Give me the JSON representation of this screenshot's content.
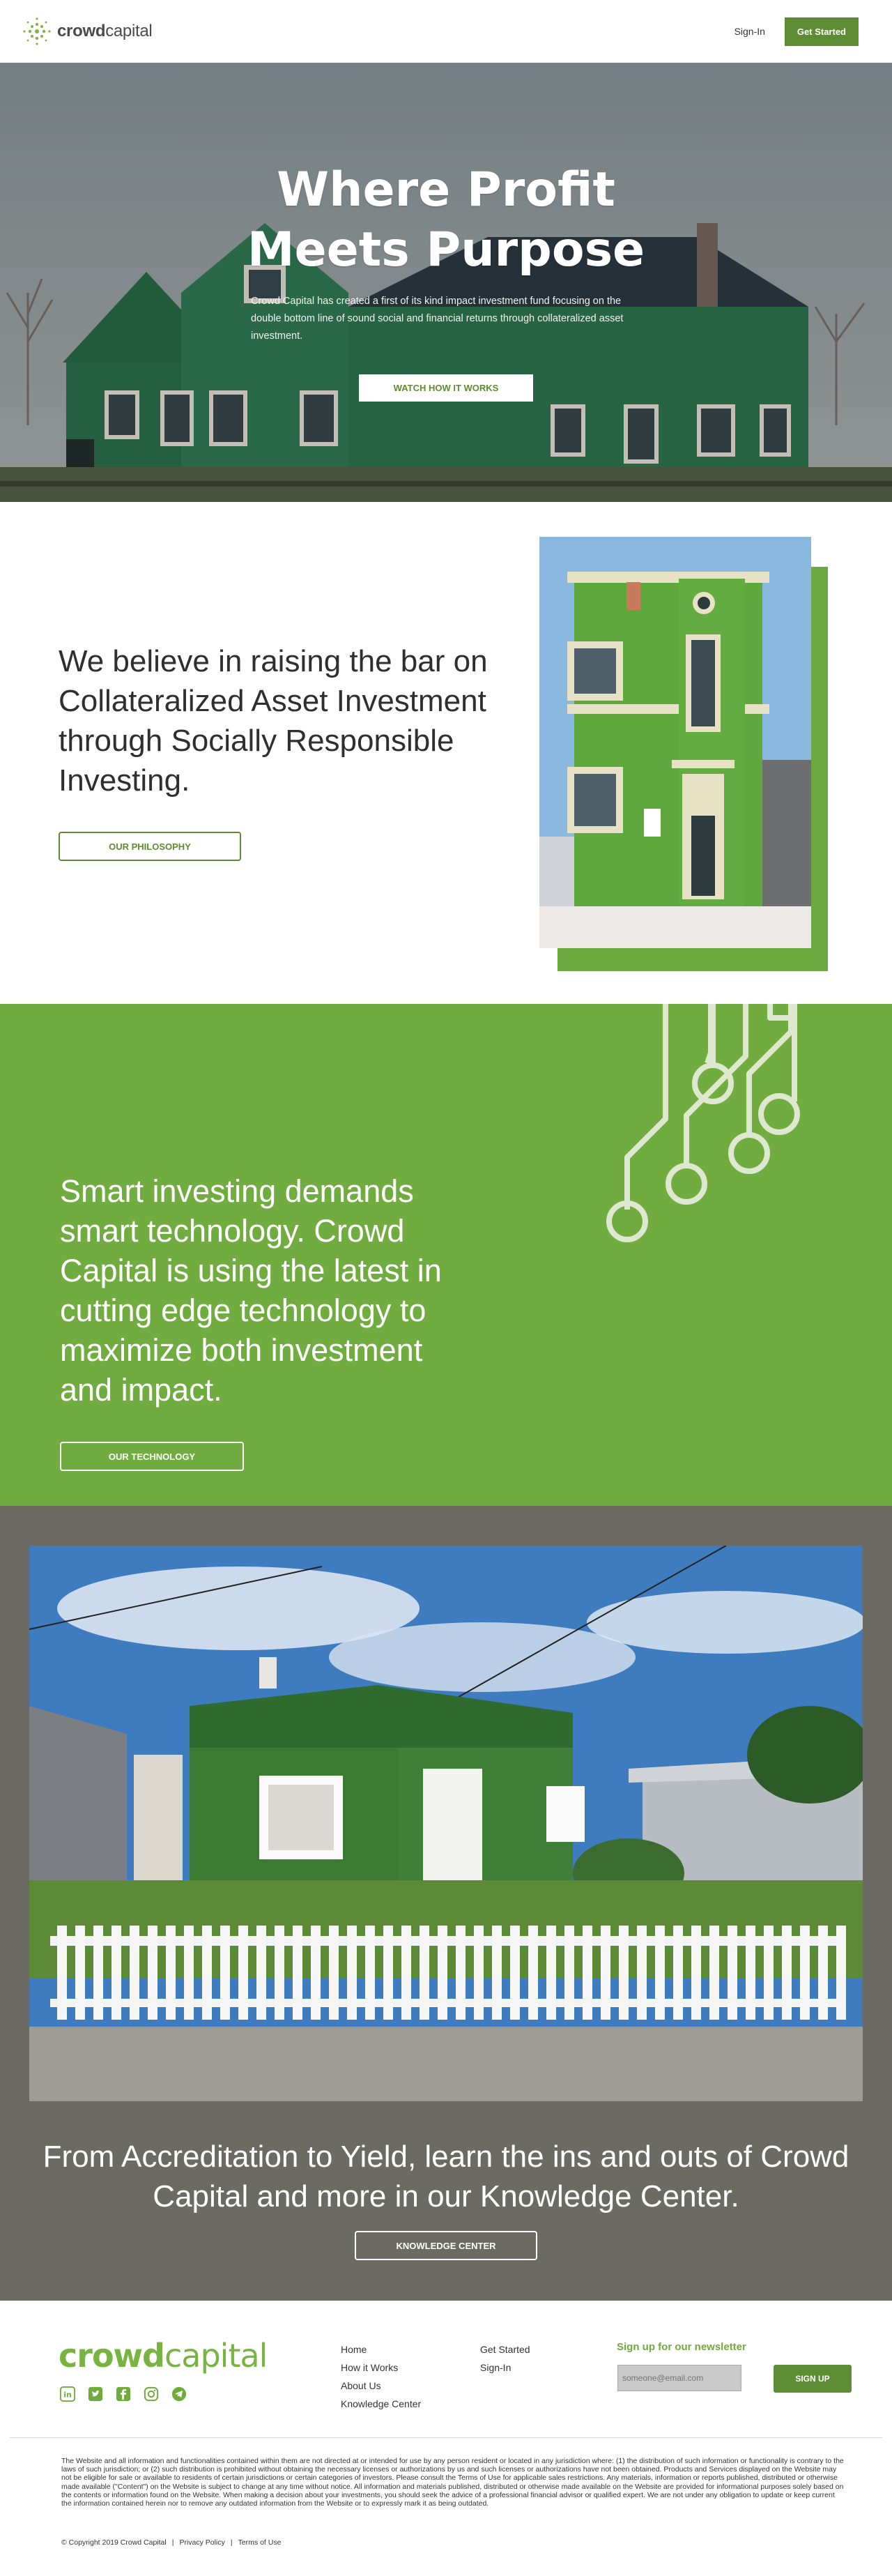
{
  "header": {
    "logo_text_bold": "crowd",
    "logo_text_light": "capital",
    "signin_label": "Sign-In",
    "get_started_label": "Get Started"
  },
  "hero": {
    "title_line1": "Where Profit",
    "title_line2": "Meets Purpose",
    "description": "Crowd Capital has created a first of its kind impact investment fund focusing on the double bottom line of sound social and financial returns through collateralized asset investment.",
    "button_label": "WATCH HOW IT WORKS"
  },
  "belief": {
    "heading": "We believe in raising the bar on Collateralized Asset Investment through Socially Responsible Investing.",
    "button_label": "OUR PHILOSOPHY"
  },
  "technology": {
    "heading": "Smart investing demands smart technology. Crowd Capital is using the latest in cutting edge technology to maximize both investment and impact.",
    "button_label": "OUR TECHNOLOGY"
  },
  "knowledge": {
    "heading": "From Accreditation to Yield, learn the ins and outs of Crowd Capital and more in our Knowledge Center.",
    "button_label": "KNOWLEDGE CENTER"
  },
  "footer": {
    "logo_bold": "crowd",
    "logo_light": "capital",
    "social_icons": [
      "linkedin-icon",
      "twitter-icon",
      "facebook-icon",
      "instagram-icon",
      "telegram-icon"
    ],
    "links_col1": [
      "Home",
      "How it Works",
      "About Us",
      "Knowledge Center"
    ],
    "links_col2": [
      "Get Started",
      "Sign-In"
    ],
    "newsletter_title": "Sign up for our newsletter",
    "newsletter_placeholder": "someone@email.com",
    "newsletter_button": "SIGN UP",
    "disclaimer": "The Website and all information and functionalities contained within them are not directed at or intended for use by any person resident or located in any jurisdiction where: (1) the distribution of such information or functionality is contrary to the laws of such jurisdiction; or (2) such distribution is prohibited without obtaining the necessary licenses or authorizations by us and such licenses or authorizations have not been obtained. Products and Services displayed on the Website may not be eligible for sale or available to residents of certain jurisdictions or certain categories of investors. Please consult the Terms of Use for applicable sales restrictions. Any materials, information or reports published, distributed or otherwise made available (\"Content\") on the Website is subject to change at any time without notice. All information and materials published, distributed or otherwise made available on the Website are provided for informational purposes solely based on the contents or information found on the Website. When making a decision about your investments, you should seek the advice of a professional financial advisor or qualified expert. We are not under any obligation to update or keep current the information contained herein nor to remove any outdated information from the Website or to expressly mark it as being outdated.",
    "copyright": "© Copyright 2019 Crowd Capital",
    "privacy_label": "Privacy Policy",
    "terms_label": "Terms of Use",
    "separator": "|"
  },
  "colors": {
    "brand_green": "#5d8c34",
    "section_green": "#71ac41",
    "knowledge_bg": "#6b6b63"
  }
}
